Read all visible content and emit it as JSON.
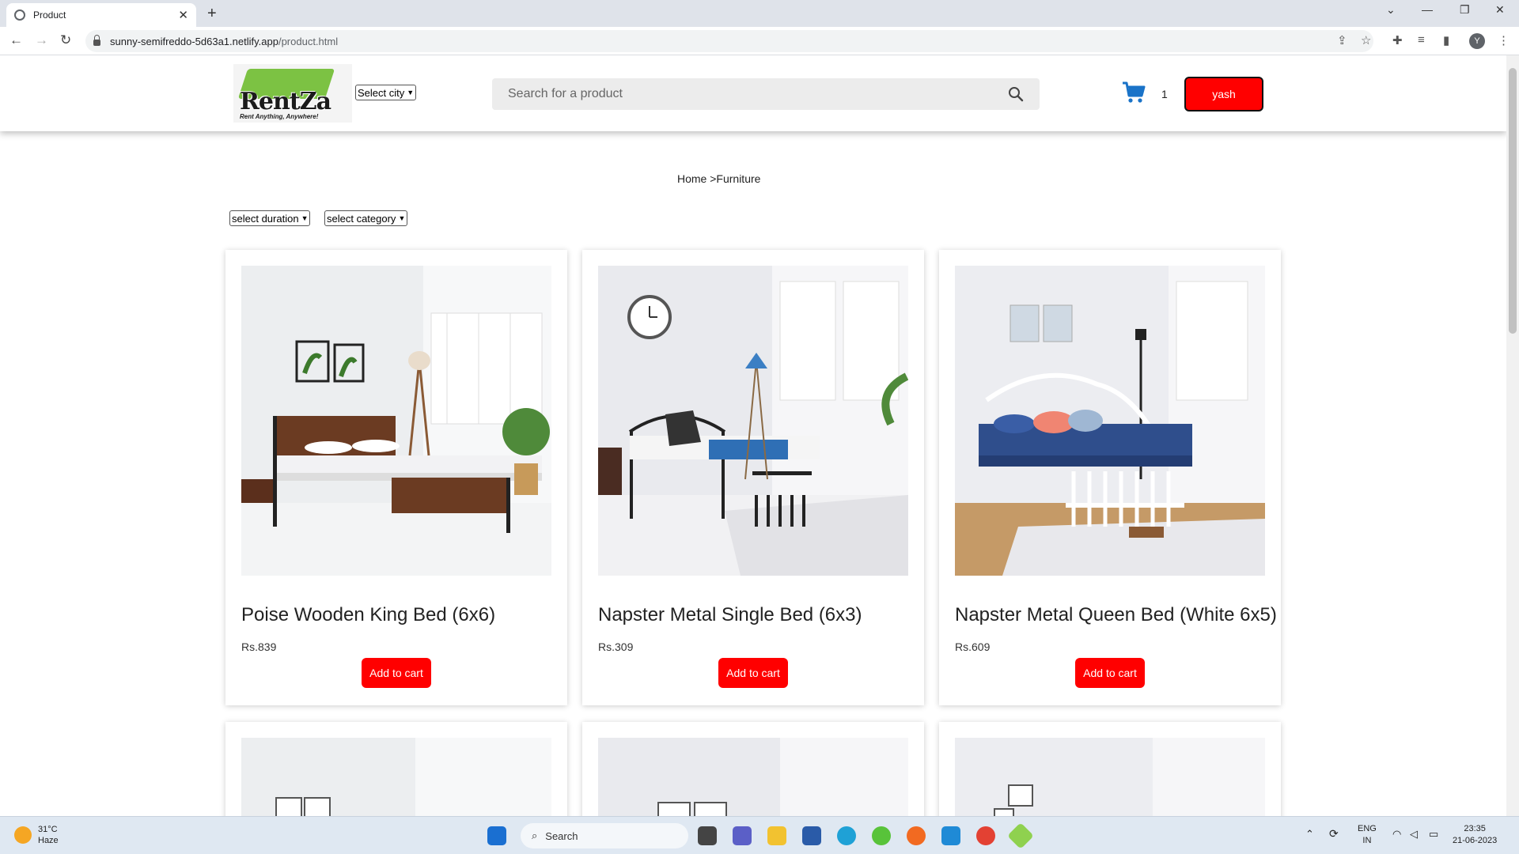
{
  "browser": {
    "tab_title": "Product",
    "tab_close": "✕",
    "new_tab": "+",
    "url_host": "sunny-semifreddo-5d63a1.netlify.app",
    "url_path": "/product.html",
    "profile_initial": "Y"
  },
  "header": {
    "logo_word": "RentZa",
    "logo_tagline": "Rent Anything, Anywhere!",
    "city_select": "Select city",
    "search_placeholder": "Search for a product",
    "cart_count": "1",
    "user_button": "yash"
  },
  "breadcrumb": "Home >Furniture",
  "filters": {
    "duration": "select duration",
    "category": "select category"
  },
  "products": [
    {
      "name": "Poise Wooden King Bed (6x6)",
      "price": "Rs.839",
      "button": "Add to cart"
    },
    {
      "name": "Napster Metal Single Bed (6x3)",
      "price": "Rs.309",
      "button": "Add to cart"
    },
    {
      "name": "Napster Metal Queen Bed (White 6x5)",
      "price": "Rs.609",
      "button": "Add to cart"
    }
  ],
  "taskbar": {
    "temperature": "31°C",
    "condition": "Haze",
    "search_label": "Search",
    "lang_top": "ENG",
    "lang_bottom": "IN",
    "time": "23:35",
    "date": "21-06-2023"
  },
  "colors": {
    "accent_red": "#ff0000",
    "cart_blue": "#1a73c8",
    "logo_green": "#7cc243"
  }
}
